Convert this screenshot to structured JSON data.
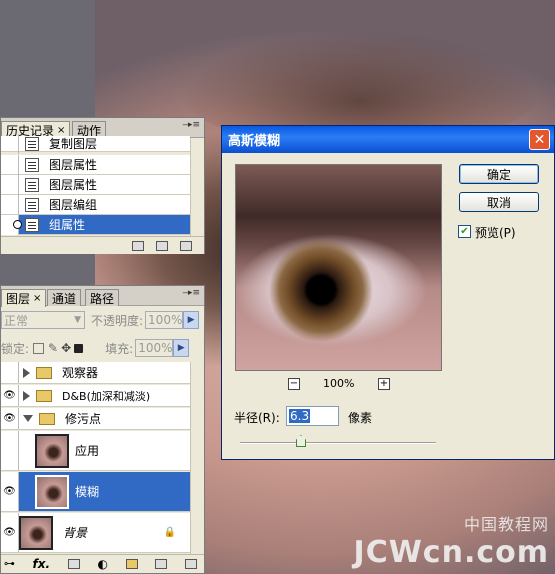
{
  "history_panel": {
    "tabs": [
      "历史记录",
      "动作"
    ],
    "close_glyph": "×",
    "items": [
      "复制图层",
      "图层属性",
      "图层属性",
      "图层编组",
      "组属性"
    ],
    "selected_index": 4
  },
  "layers_panel": {
    "tabs": [
      "图层",
      "通道",
      "路径"
    ],
    "blend_mode": "正常",
    "opacity_label": "不透明度:",
    "opacity_value": "100%",
    "lock_label": "锁定:",
    "fill_label": "填充:",
    "fill_value": "100%",
    "layers": [
      {
        "name": "观察器",
        "type": "group",
        "open": false
      },
      {
        "name": "D&B(加深和减淡)",
        "type": "group",
        "open": false
      },
      {
        "name": "修污点",
        "type": "group",
        "open": true
      },
      {
        "name": "应用",
        "type": "layer"
      },
      {
        "name": "模糊",
        "type": "layer",
        "selected": true
      },
      {
        "name": "背景",
        "type": "layer",
        "locked": true
      }
    ],
    "footer_fx": "fx."
  },
  "dialog": {
    "title": "高斯模糊",
    "ok": "确定",
    "cancel": "取消",
    "preview_label": "预览(P)",
    "preview_checked": true,
    "zoom_out": "−",
    "zoom_in": "+",
    "zoom": "100%",
    "radius_label": "半径(R):",
    "radius_value": "6.3",
    "unit": "像素",
    "close_glyph": "✕"
  },
  "watermark": {
    "cn": "中国教程网",
    "en": "JCWcn.com"
  },
  "colors": {
    "selection": "#316ac5",
    "title_bar": "#0a58e0",
    "close_button": "#e3562e"
  }
}
